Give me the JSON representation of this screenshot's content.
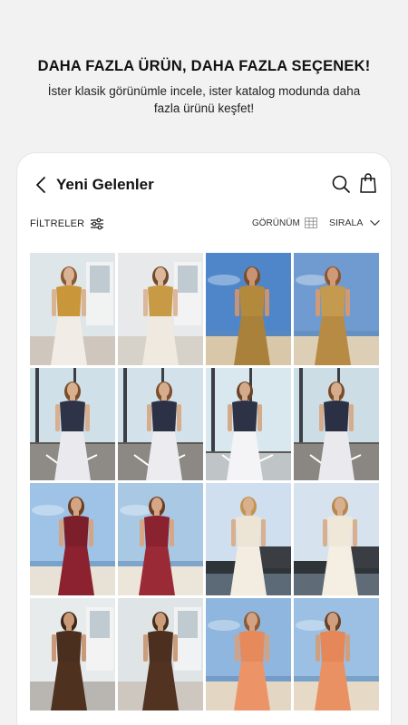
{
  "promo": {
    "title": "DAHA FAZLA ÜRÜN, DAHA FAZLA SEÇENEK!",
    "subtitle": "İster klasik görünümle incele, ister katalog  modunda daha fazla ürünü keşfet!"
  },
  "header": {
    "title": "Yeni Gelenler"
  },
  "toolbar": {
    "filters_label": "FİLTRELER",
    "view_label": "GÖRÜNÜM",
    "sort_label": "SIRALA"
  },
  "colors": {
    "background": "#f2f2f2",
    "card": "#ffffff",
    "text": "#111111"
  },
  "products": [
    {
      "scene": "terrace",
      "sky": "#dfe6ea",
      "ground": "#cfc7bd",
      "outfit": "#c9963a",
      "skirt": "#f1ede6",
      "skin": "#d9b394",
      "hair": "#8a5a34"
    },
    {
      "scene": "terrace",
      "sky": "#e7e9ea",
      "ground": "#d6d1c9",
      "outfit": "#c89a45",
      "skirt": "#efe9df",
      "skin": "#dcb79b",
      "hair": "#6e4a2c"
    },
    {
      "scene": "beach",
      "sky": "#4f86c9",
      "ground": "#d8c7a8",
      "outfit": "#b38a3c",
      "skirt": "#a9813a",
      "skin": "#c99474",
      "hair": "#7a4d2a"
    },
    {
      "scene": "beach",
      "sky": "#6f9bd0",
      "ground": "#ddcfb5",
      "outfit": "#c49a4f",
      "skirt": "#b78b43",
      "skin": "#cf9a78",
      "hair": "#8b5530"
    },
    {
      "scene": "deck",
      "sky": "#cfe0e9",
      "ground": "#8e8a86",
      "outfit": "#2f3348",
      "skirt": "#e9e9ee",
      "skin": "#d8b08f",
      "hair": "#7a4d2a"
    },
    {
      "scene": "deck",
      "sky": "#d3e2ea",
      "ground": "#8c8884",
      "outfit": "#2d3146",
      "skirt": "#ececf0",
      "skin": "#d6ad8c",
      "hair": "#7c4e2b"
    },
    {
      "scene": "glass",
      "sky": "#d9e7ee",
      "ground": "#bfc4c6",
      "outfit": "#2e3246",
      "skirt": "#f4f4f6",
      "skin": "#d4ab8a",
      "hair": "#6d4326"
    },
    {
      "scene": "deck",
      "sky": "#cddde6",
      "ground": "#8a8682",
      "outfit": "#2c3045",
      "skirt": "#eaeaee",
      "skin": "#d6ad8c",
      "hair": "#7a4d2a"
    },
    {
      "scene": "dune",
      "sky": "#9ec3e6",
      "ground": "#e8e2d6",
      "outfit": "#7d1f2b",
      "skirt": "#8c2230",
      "skin": "#d3a585",
      "hair": "#6b3e22"
    },
    {
      "scene": "dune",
      "sky": "#a8c8e4",
      "ground": "#ece6da",
      "outfit": "#8a2230",
      "skirt": "#9a2a36",
      "skin": "#d5a786",
      "hair": "#6a3d21"
    },
    {
      "scene": "sea",
      "sky": "#cfdff0",
      "ground": "#5c6a78",
      "outfit": "#ece4d4",
      "skirt": "#f3ece0",
      "skin": "#d8b08f",
      "hair": "#c4934e"
    },
    {
      "scene": "sea",
      "sky": "#d6e3ef",
      "ground": "#5f6b77",
      "outfit": "#efe7d8",
      "skirt": "#f4eee3",
      "skin": "#d8b08f",
      "hair": "#b8864b"
    },
    {
      "scene": "terrace",
      "sky": "#e8ebec",
      "ground": "#b9b6b2",
      "outfit": "#4a2e1e",
      "skirt": "#4f3120",
      "skin": "#c99a78",
      "hair": "#3b2518"
    },
    {
      "scene": "terrace",
      "sky": "#dfe4e6",
      "ground": "#cdc7bf",
      "outfit": "#4c2f1f",
      "skirt": "#523322",
      "skin": "#cc9d7b",
      "hair": "#4a2e1c"
    },
    {
      "scene": "beach",
      "sky": "#8fb6de",
      "ground": "#e3d6c2",
      "outfit": "#e68a5c",
      "skirt": "#ec9468",
      "skin": "#d3a282",
      "hair": "#8c5a33"
    },
    {
      "scene": "beach",
      "sky": "#9cc0e3",
      "ground": "#e6dac6",
      "outfit": "#e58758",
      "skirt": "#ea9164",
      "skin": "#cfa07f",
      "hair": "#6b4226"
    }
  ]
}
